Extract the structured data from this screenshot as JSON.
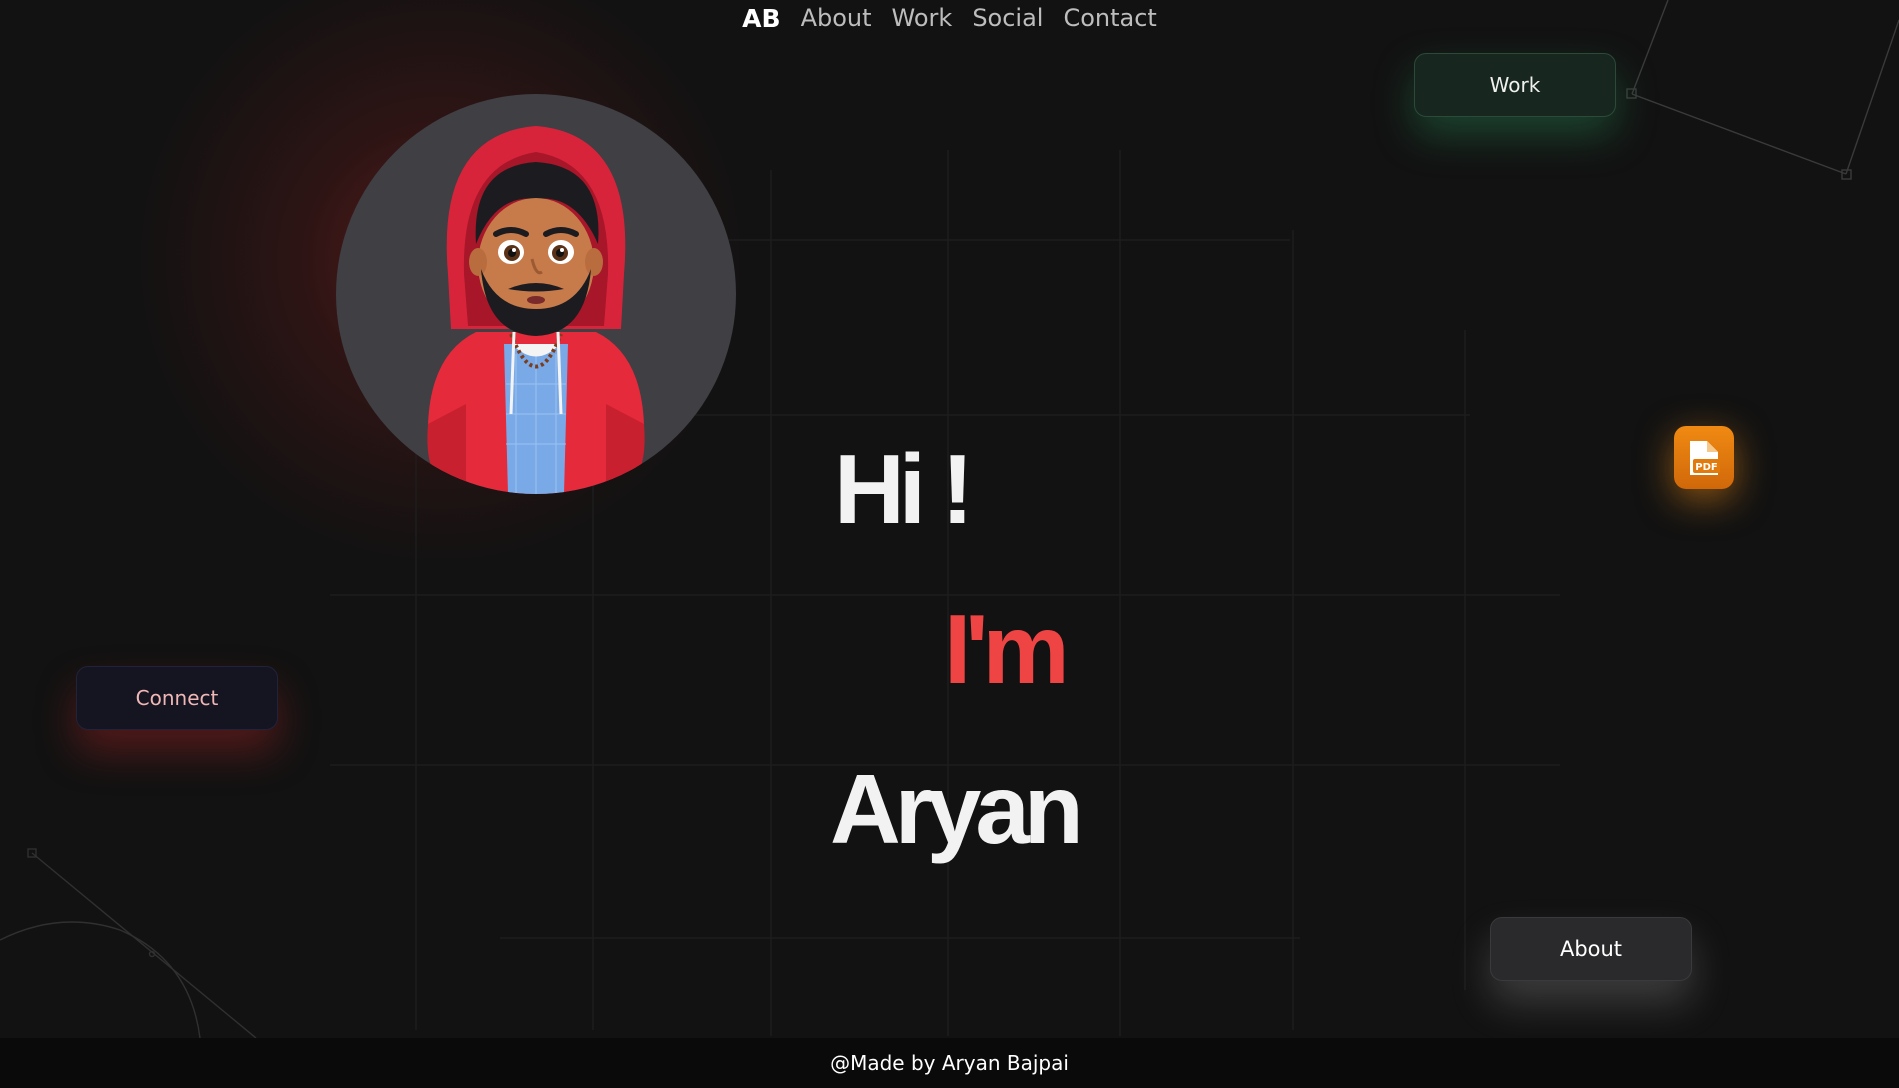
{
  "nav": {
    "logo": "AB",
    "links": [
      "About",
      "Work",
      "Social",
      "Contact"
    ]
  },
  "hero": {
    "line1": "Hi !",
    "line2": "I'm",
    "line3": "Aryan"
  },
  "buttons": {
    "work": "Work",
    "connect": "Connect",
    "about": "About"
  },
  "pdf": {
    "label": "PDF",
    "icon": "pdf-file-icon"
  },
  "footer": {
    "text": "@Made by Aryan Bajpai"
  },
  "colors": {
    "background": "#121212",
    "accent": "#ef4444",
    "pdf_orange": "#f08a12",
    "avatar_bg": "#3f3f44"
  }
}
